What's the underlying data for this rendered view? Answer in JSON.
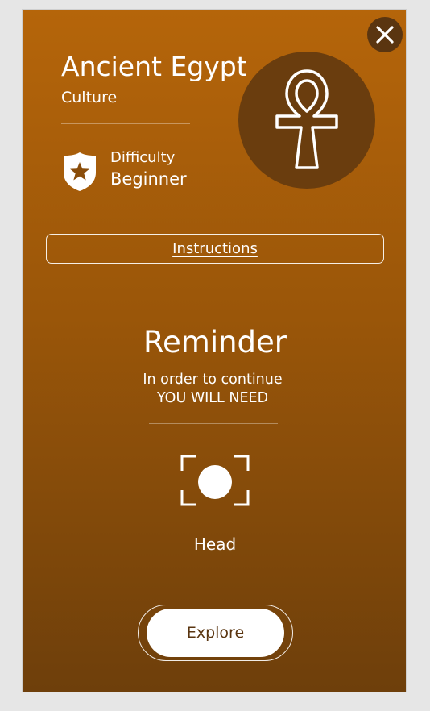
{
  "card": {
    "title": "Ancient Egypt",
    "subtitle": "Culture",
    "emblem_icon": "ankh-icon",
    "close_icon": "close-icon",
    "difficulty": {
      "icon": "shield-star-icon",
      "label": "Difficulty",
      "value": "Beginner"
    },
    "instructions_label": "Instructions"
  },
  "reminder": {
    "title": "Reminder",
    "line1": "In order to continue",
    "line2": "YOU WILL NEED",
    "requirement_icon": "face-scan-icon",
    "requirement_label": "Head"
  },
  "actions": {
    "explore_label": "Explore"
  },
  "colors": {
    "gradient_top": "#b5650a",
    "gradient_bottom": "#6e3f0b",
    "emblem_bg": "#6a3d0e",
    "close_bg": "#5a3510",
    "button_text": "#5a3510"
  }
}
